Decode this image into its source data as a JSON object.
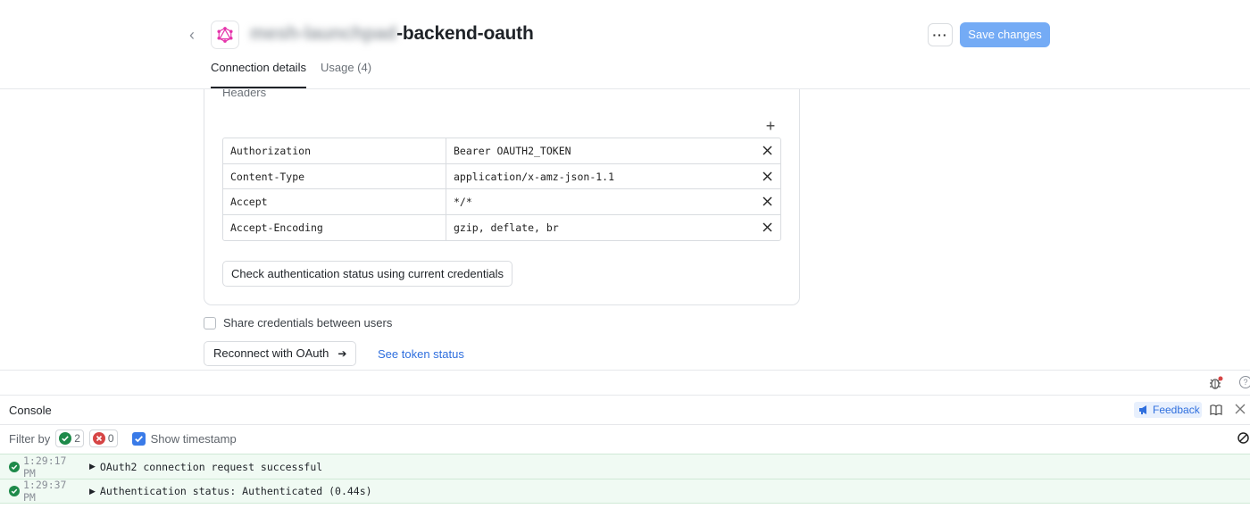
{
  "header": {
    "title_blurred": "mesh-launchpad",
    "title_suffix": "-backend-oauth",
    "more_label": "···",
    "save_label": "Save changes",
    "tabs": [
      {
        "label": "Connection details",
        "active": true
      },
      {
        "label": "Usage",
        "count": "(4)",
        "active": false
      }
    ]
  },
  "headers_section": {
    "label": "Headers",
    "rows": [
      {
        "key": "Authorization",
        "value": "Bearer OAUTH2_TOKEN"
      },
      {
        "key": "Content-Type",
        "value": "application/x-amz-json-1.1"
      },
      {
        "key": "Accept",
        "value": "*/*"
      },
      {
        "key": "Accept-Encoding",
        "value": "gzip, deflate, br"
      }
    ],
    "check_button": "Check authentication status using current credentials"
  },
  "share": {
    "label": "Share credentials between users",
    "checked": false
  },
  "reconnect": {
    "label": "Reconnect with OAuth",
    "arrow": "➔"
  },
  "token_link": "See token status",
  "console": {
    "tab": "Console",
    "feedback": "Feedback",
    "filter_label": "Filter by",
    "success_count": "2",
    "error_count": "0",
    "show_timestamp": "Show timestamp",
    "show_timestamp_checked": true,
    "logs": [
      {
        "time": "1:29:17 PM",
        "message": "OAuth2 connection request successful"
      },
      {
        "time": "1:29:37 PM",
        "message": "Authentication status: Authenticated (0.44s)"
      }
    ]
  },
  "colors": {
    "accent": "#74abf5",
    "link": "#2f6fde",
    "success": "#1e8a4a",
    "error": "#d64545",
    "graphql": "#e535ab"
  }
}
